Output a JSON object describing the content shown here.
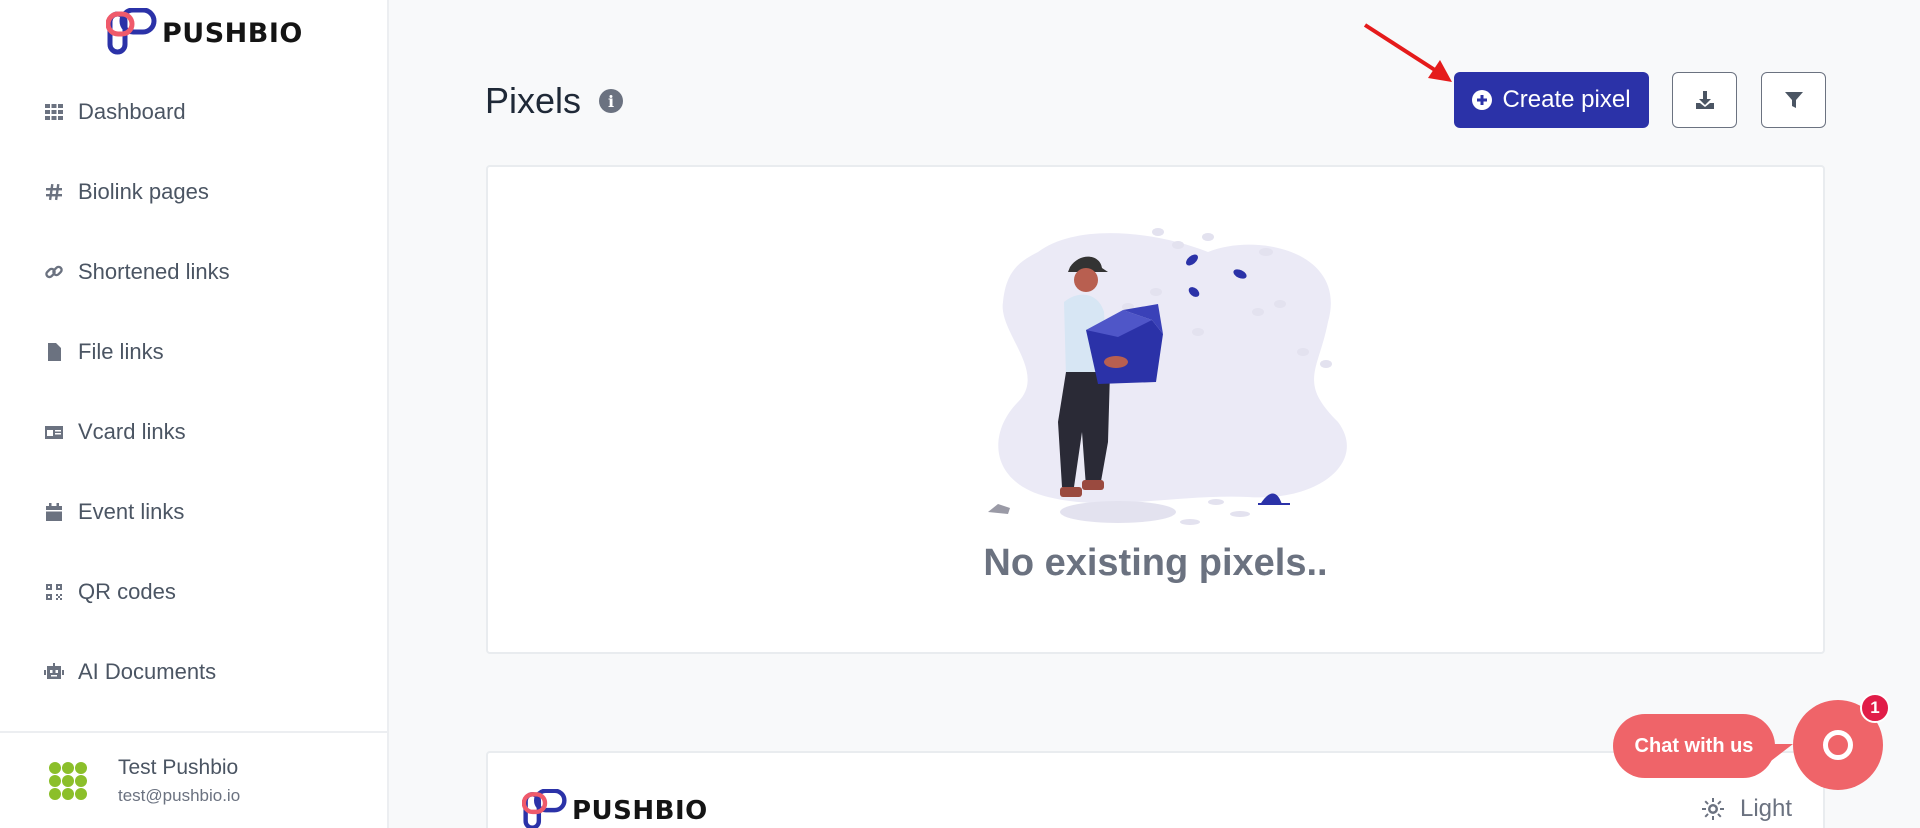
{
  "brand": {
    "name": "PUSHBIO"
  },
  "sidebar": {
    "items": [
      {
        "label": "Dashboard",
        "icon": "grid-icon"
      },
      {
        "label": "Biolink pages",
        "icon": "hashtag-icon"
      },
      {
        "label": "Shortened links",
        "icon": "link-icon"
      },
      {
        "label": "File links",
        "icon": "file-icon"
      },
      {
        "label": "Vcard links",
        "icon": "id-card-icon"
      },
      {
        "label": "Event links",
        "icon": "calendar-icon"
      },
      {
        "label": "QR codes",
        "icon": "qrcode-icon"
      },
      {
        "label": "AI Documents",
        "icon": "robot-icon"
      }
    ]
  },
  "user": {
    "name": "Test Pushbio",
    "email": "test@pushbio.io"
  },
  "header": {
    "title": "Pixels",
    "create_label": "Create pixel"
  },
  "empty_state": {
    "message": "No existing pixels.."
  },
  "footer": {
    "theme_label": "Light"
  },
  "chat": {
    "label": "Chat with us",
    "badge_count": "1"
  },
  "colors": {
    "primary": "#2b32a8",
    "chat": "#ef6469",
    "badge": "#e11d48"
  }
}
